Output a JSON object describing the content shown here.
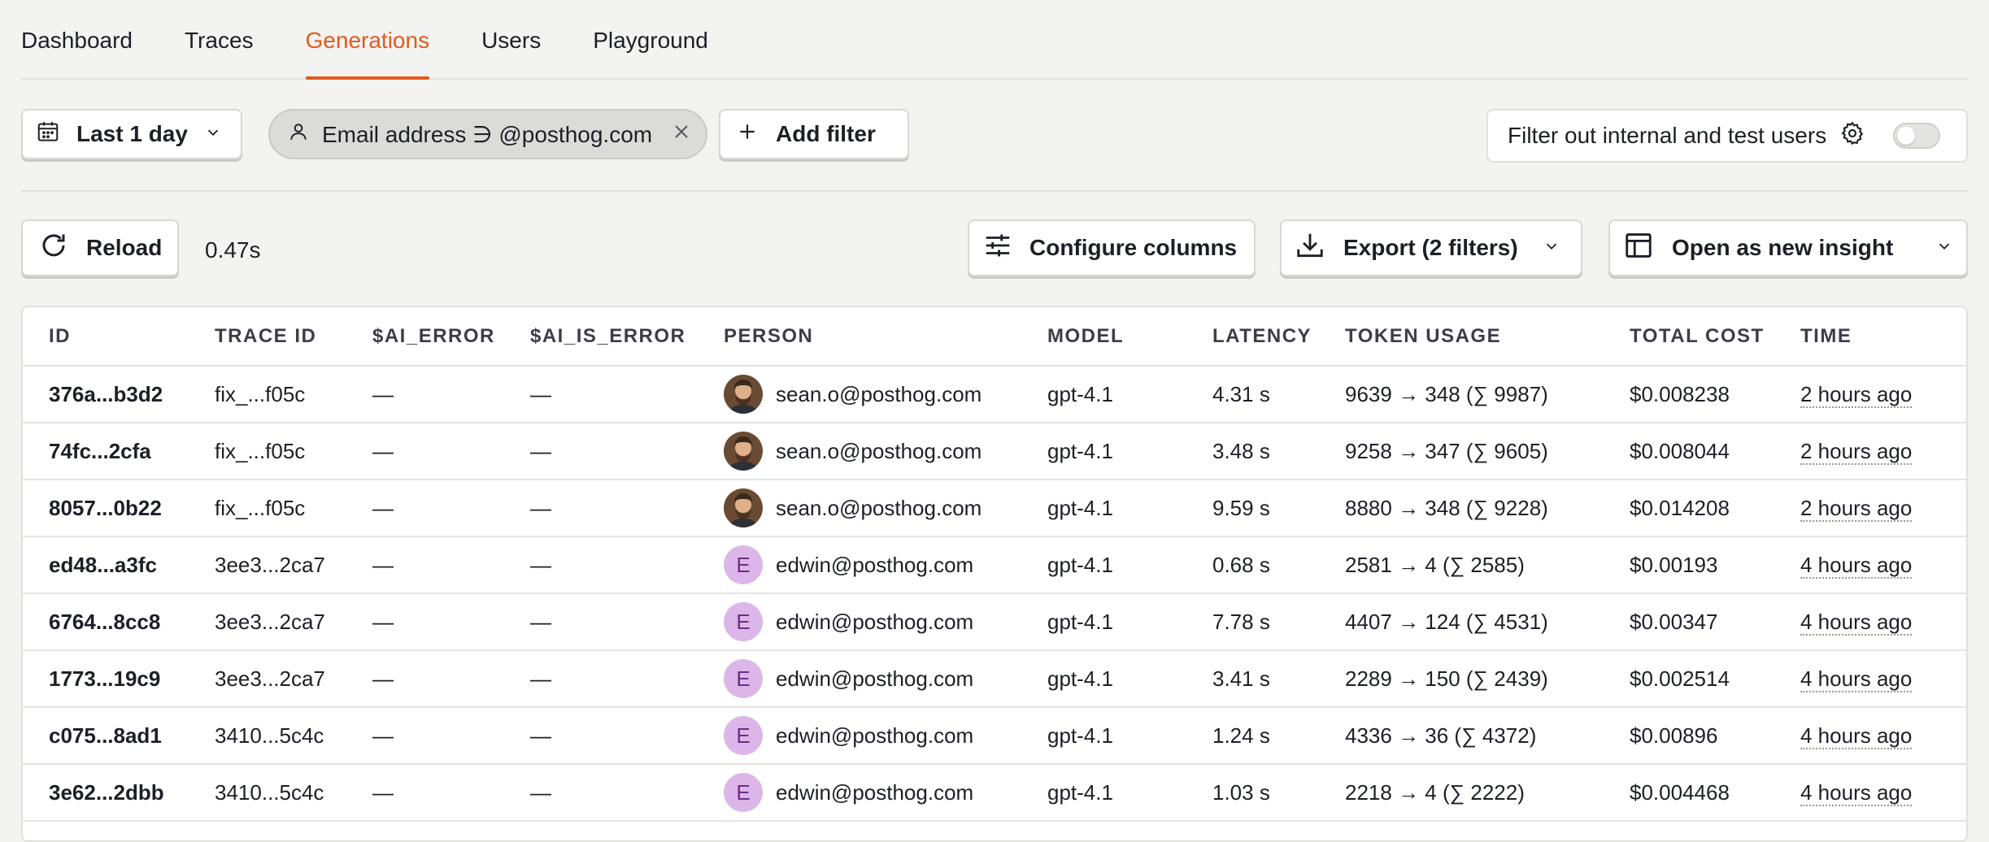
{
  "tabs": [
    "Dashboard",
    "Traces",
    "Generations",
    "Users",
    "Playground"
  ],
  "active_tab": "Generations",
  "filters": {
    "date_range_label": "Last 1 day",
    "chip_label": "Email address ∋ @posthog.com",
    "add_filter_label": "Add filter",
    "internal_users_label": "Filter out internal and test users",
    "internal_users_toggle": false
  },
  "toolbar": {
    "reload_label": "Reload",
    "elapsed": "0.47s",
    "configure_label": "Configure columns",
    "export_label": "Export (2 filters)",
    "insight_label": "Open as new insight"
  },
  "table": {
    "columns": [
      "ID",
      "TRACE ID",
      "$AI_ERROR",
      "$AI_IS_ERROR",
      "PERSON",
      "MODEL",
      "LATENCY",
      "TOKEN USAGE",
      "TOTAL COST",
      "TIME"
    ],
    "rows": [
      {
        "id": "376a...b3d2",
        "trace_id": "fix_...f05c",
        "ai_error": "—",
        "ai_is_error": "—",
        "avatar": "photo",
        "person": "sean.o@posthog.com",
        "model": "gpt-4.1",
        "latency": "4.31 s",
        "tokens": "9639 → 348 (∑ 9987)",
        "cost": "$0.008238",
        "time": "2 hours ago"
      },
      {
        "id": "74fc...2cfa",
        "trace_id": "fix_...f05c",
        "ai_error": "—",
        "ai_is_error": "—",
        "avatar": "photo",
        "person": "sean.o@posthog.com",
        "model": "gpt-4.1",
        "latency": "3.48 s",
        "tokens": "9258 → 347 (∑ 9605)",
        "cost": "$0.008044",
        "time": "2 hours ago"
      },
      {
        "id": "8057...0b22",
        "trace_id": "fix_...f05c",
        "ai_error": "—",
        "ai_is_error": "—",
        "avatar": "photo",
        "person": "sean.o@posthog.com",
        "model": "gpt-4.1",
        "latency": "9.59 s",
        "tokens": "8880 → 348 (∑ 9228)",
        "cost": "$0.014208",
        "time": "2 hours ago"
      },
      {
        "id": "ed48...a3fc",
        "trace_id": "3ee3...2ca7",
        "ai_error": "—",
        "ai_is_error": "—",
        "avatar": "E",
        "person": "edwin@posthog.com",
        "model": "gpt-4.1",
        "latency": "0.68 s",
        "tokens": "2581 → 4 (∑ 2585)",
        "cost": "$0.00193",
        "time": "4 hours ago"
      },
      {
        "id": "6764...8cc8",
        "trace_id": "3ee3...2ca7",
        "ai_error": "—",
        "ai_is_error": "—",
        "avatar": "E",
        "person": "edwin@posthog.com",
        "model": "gpt-4.1",
        "latency": "7.78 s",
        "tokens": "4407 → 124 (∑ 4531)",
        "cost": "$0.00347",
        "time": "4 hours ago"
      },
      {
        "id": "1773...19c9",
        "trace_id": "3ee3...2ca7",
        "ai_error": "—",
        "ai_is_error": "—",
        "avatar": "E",
        "person": "edwin@posthog.com",
        "model": "gpt-4.1",
        "latency": "3.41 s",
        "tokens": "2289 → 150 (∑ 2439)",
        "cost": "$0.002514",
        "time": "4 hours ago"
      },
      {
        "id": "c075...8ad1",
        "trace_id": "3410...5c4c",
        "ai_error": "—",
        "ai_is_error": "—",
        "avatar": "E",
        "person": "edwin@posthog.com",
        "model": "gpt-4.1",
        "latency": "1.24 s",
        "tokens": "4336 → 36 (∑ 4372)",
        "cost": "$0.00896",
        "time": "4 hours ago"
      },
      {
        "id": "3e62...2dbb",
        "trace_id": "3410...5c4c",
        "ai_error": "—",
        "ai_is_error": "—",
        "avatar": "E",
        "person": "edwin@posthog.com",
        "model": "gpt-4.1",
        "latency": "1.03 s",
        "tokens": "2218 → 4 (∑ 2222)",
        "cost": "$0.004468",
        "time": "4 hours ago"
      }
    ]
  },
  "colors": {
    "accent": "#e25a1c",
    "avatar_letter_bg": "#dcb6e8"
  }
}
